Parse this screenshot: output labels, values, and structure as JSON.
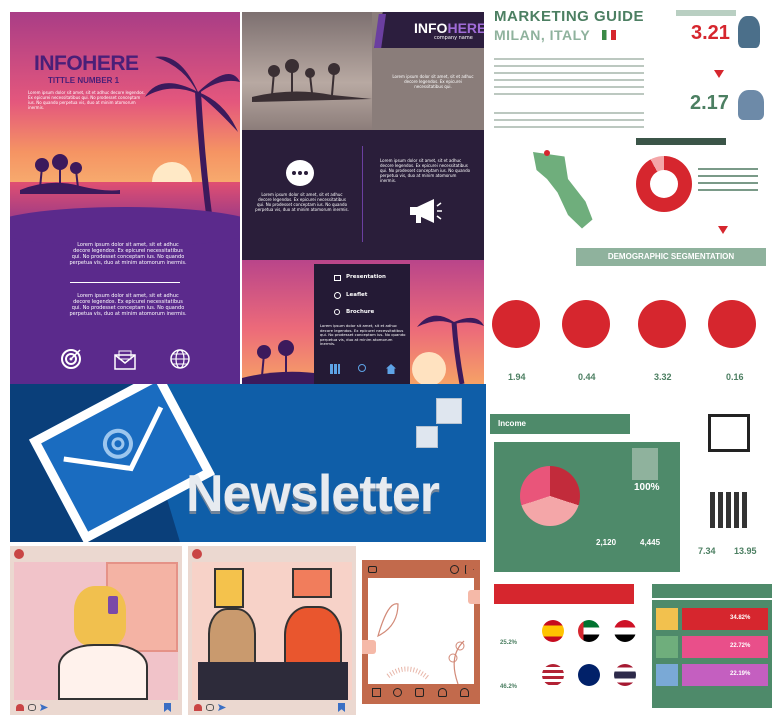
{
  "flyer": {
    "brand": "INFOHERE",
    "subtitle": "TITTLE NUMBER 1",
    "body_1": "Lorem ipsum dolor sit amet, sit et adhuc decore legendos. Ex epicurei necessitatibus qui. No prodesset conceptam ius. No quando perpetua vis, duo at minim atomorum inermis.",
    "body_2": "Lorem ipsum dolor sit amet, sit et adhuc decore legendos. Ex epicurei necessitatibus qui. No prodesset conceptam ius. No quando perpetua vis, duo at minim atomorum inermis.",
    "body_3": "Lorem ipsum dolor sit amet, sit et adhuc decore legendos. Ex epicurei necessitatibus qui. No prodesset conceptam ius. No quando perpetua vis, duo at minim atomorum inermis.",
    "icons": [
      "target-icon",
      "mail-icon",
      "globe-icon"
    ]
  },
  "brochure": {
    "brand_a": "INFO",
    "brand_b": "HERE",
    "company": "company name",
    "intro": "Lorem ipsum dolor sit amet, sit et adhuc decore legendos. Ex epicurei necessitatibus qui.",
    "left_text": "Lorem ipsum dolor sit amet, sit et adhuc decore legendos. Ex epicurei necessitatibus qui. No prodesset conceptam ius. No quando perpetua vis, duo at minim atomorum inermis.",
    "right_text": "Lorem ipsum dolor sit amet, sit et adhuc decore legendos. Ex epicurei necessitatibus qui. No prodesset conceptam ius. No quando perpetua vis, duo at minim atomorum inermis.",
    "menu": [
      "Presentation",
      "Leaflet",
      "Brochure"
    ],
    "menu_text": "Lorem ipsum dolor sit amet, sit et adhuc decore legendos. Ex epicurei necessitatibus qui. No prodesset conceptam ius. No quando perpetua vis, duo at minim atomorum inermis."
  },
  "banner": {
    "title": "Newsletter"
  },
  "infographic": {
    "title": "MARKETING GUIDE",
    "city": "MILAN, ITALY",
    "stat_1": "3.21",
    "stat_2": "2.17",
    "section_demo": "DEMOGRAPHIC SEGMENTATION",
    "age_values": [
      "1.94",
      "0.44",
      "3.32",
      "0.16"
    ],
    "section_income": "Income",
    "pie_pct": "100%",
    "income_values": [
      "2,120",
      "4,445"
    ],
    "cal_values": [
      "7.34",
      "13.95"
    ],
    "bars": [
      "34.82%",
      "22.72%",
      "22.19%"
    ],
    "pct_left": [
      "25.2%",
      "46.2%"
    ]
  },
  "colors": {
    "purple": "#5b2a8c",
    "pink": "#e8507a",
    "orange": "#f7a35a",
    "navy": "#1d1638",
    "blue": "#0f5ea8",
    "red": "#d6262e",
    "green": "#4e8a6a"
  }
}
